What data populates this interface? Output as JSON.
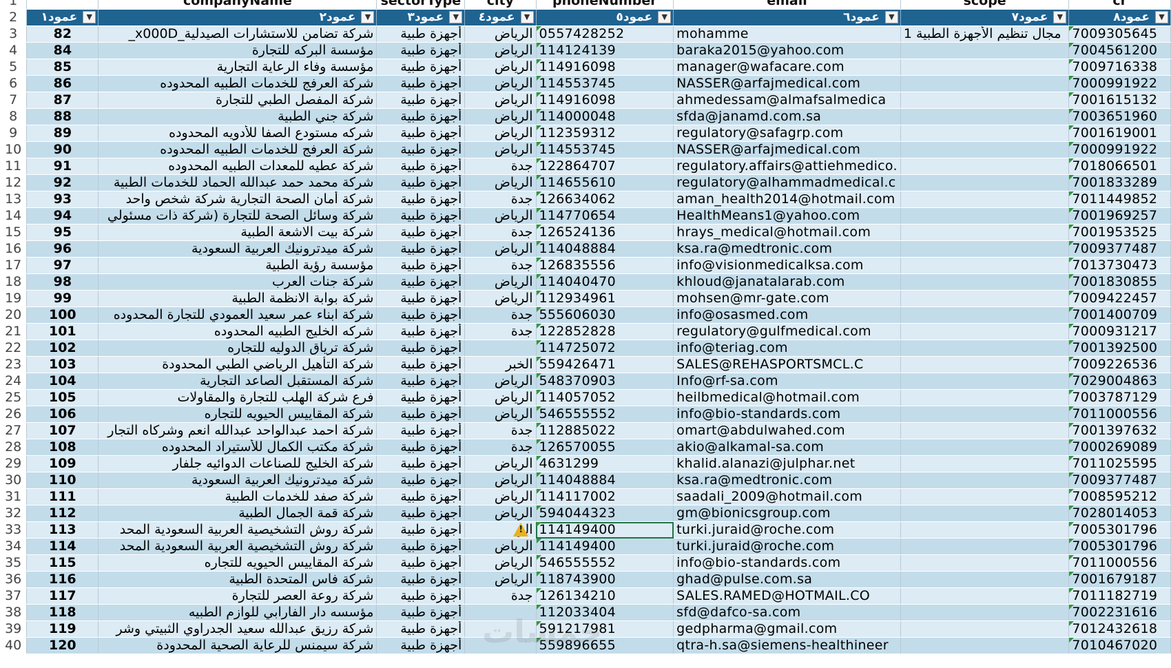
{
  "column_headers": {
    "row_label": "1",
    "companyName": "companyName",
    "sectorType": "sectorType",
    "city": "city",
    "phoneNumber": "phoneNumber",
    "email": "email",
    "scope": "scope",
    "cr": "cr"
  },
  "filter_row": {
    "row_label": "2",
    "col_a": "عمود١",
    "col_b": "عمود٢",
    "col_c": "عمود٣",
    "col_d": "عمود٤",
    "col_e": "عمود٥",
    "col_f": "عمود٦",
    "col_g": "عمود٧",
    "col_h": "عمود٨"
  },
  "rows": [
    {
      "r": "3",
      "num": "82",
      "name": "شركة تضامن للاستشارات الصيدلية_x000D_",
      "sector": "أجهزة طبية",
      "city": "الرياض",
      "phone": "0557428252",
      "email": "mohamme",
      "scope": "مجال تنظيم الأجهزة الطبية 1",
      "cr": "7009305645"
    },
    {
      "r": "4",
      "num": "84",
      "name": "مؤسسة البركه للتجارة",
      "sector": "أجهزة طبية",
      "city": "الرياض",
      "phone": "114124139",
      "email": "baraka2015@yahoo.com",
      "scope": "",
      "cr": "7004561200"
    },
    {
      "r": "5",
      "num": "85",
      "name": "مؤسسة وفاء الرعاية التجارية",
      "sector": "أجهزة طبية",
      "city": "الرياض",
      "phone": "114916098",
      "email": "manager@wafacare.com",
      "scope": "",
      "cr": "7009716338"
    },
    {
      "r": "6",
      "num": "86",
      "name": "شركة العرفج للخدمات الطبيه المحدوده",
      "sector": "أجهزة طبية",
      "city": "الرياض",
      "phone": "114553745",
      "email": "NASSER@arfajmedical.com",
      "scope": "",
      "cr": "7000991922"
    },
    {
      "r": "7",
      "num": "87",
      "name": "شركة المفصل الطبي للتجارة",
      "sector": "أجهزة طبية",
      "city": "الرياض",
      "phone": "114916098",
      "email": "ahmedessam@almafsalmedica",
      "scope": "",
      "cr": "7001615132"
    },
    {
      "r": "8",
      "num": "88",
      "name": "شركة جني الطبية",
      "sector": "أجهزة طبية",
      "city": "الرياض",
      "phone": "114000048",
      "email": "sfda@janamd.com.sa",
      "scope": "",
      "cr": "7003651960"
    },
    {
      "r": "9",
      "num": "89",
      "name": "شركه مستودع الصفا للأدويه المحدوده",
      "sector": "أجهزة طبية",
      "city": "الرياض",
      "phone": "112359312",
      "email": "regulatory@safagrp.com",
      "scope": "",
      "cr": "7001619001"
    },
    {
      "r": "10",
      "num": "90",
      "name": "شركة العرفج للخدمات الطبيه المحدوده",
      "sector": "أجهزة طبية",
      "city": "الرياض",
      "phone": "114553745",
      "email": "NASSER@arfajmedical.com",
      "scope": "",
      "cr": "7000991922"
    },
    {
      "r": "11",
      "num": "91",
      "name": "شركة عطيه للمعدات الطبيه المحدوده",
      "sector": "أجهزة طبية",
      "city": "جدة",
      "phone": "122864707",
      "email": "regulatory.affairs@attiehmedico.",
      "scope": "",
      "cr": "7018066501"
    },
    {
      "r": "12",
      "num": "92",
      "name": "شركة محمد حمد عبدالله الحماد للخدمات الطبية",
      "sector": "أجهزة طبية",
      "city": "الرياض",
      "phone": "114655610",
      "email": "regulatory@alhammadmedical.c",
      "scope": "",
      "cr": "7001833289"
    },
    {
      "r": "13",
      "num": "93",
      "name": "شركة أمان الصحة التجارية شركة شخص واحد",
      "sector": "أجهزة طبية",
      "city": "جدة",
      "phone": "126634062",
      "email": "aman_health2014@hotmail.com",
      "scope": "",
      "cr": "7011449852"
    },
    {
      "r": "14",
      "num": "94",
      "name": "شركة وسائل الصحة للتجارة (شركة ذات مسئولي",
      "sector": "أجهزة طبية",
      "city": "الرياض",
      "phone": "114770654",
      "email": "HealthMeans1@yahoo.com",
      "scope": "",
      "cr": "7001969257"
    },
    {
      "r": "15",
      "num": "95",
      "name": "شركة بيت الاشعة الطبية",
      "sector": "أجهزة طبية",
      "city": "جدة",
      "phone": "126524136",
      "email": "hrays_medical@hotmail.com",
      "scope": "",
      "cr": "7001953525"
    },
    {
      "r": "16",
      "num": "96",
      "name": "شركة ميدترونيك العربية السعودية",
      "sector": "أجهزة طبية",
      "city": "الرياض",
      "phone": "114048884",
      "email": "ksa.ra@medtronic.com",
      "scope": "",
      "cr": "7009377487"
    },
    {
      "r": "17",
      "num": "97",
      "name": "مؤسسة رؤية الطبية",
      "sector": "أجهزة طبية",
      "city": "جدة",
      "phone": "126835556",
      "email": "info@visionmedicalksa.com",
      "scope": "",
      "cr": "7013730473"
    },
    {
      "r": "18",
      "num": "98",
      "name": "شركة جنات العرب",
      "sector": "أجهزة طبية",
      "city": "الرياض",
      "phone": "114040470",
      "email": "khloud@janatalarab.com",
      "scope": "",
      "cr": "7001830855"
    },
    {
      "r": "19",
      "num": "99",
      "name": "شركة بوابة الانظمة الطبية",
      "sector": "أجهزة طبية",
      "city": "الرياض",
      "phone": "112934961",
      "email": "mohsen@mr-gate.com",
      "scope": "",
      "cr": "7009422457"
    },
    {
      "r": "20",
      "num": "100",
      "name": "شركة ابناء عمر سعيد العمودي للتجارة المحدوده",
      "sector": "أجهزة طبية",
      "city": "جدة",
      "phone": "555606030",
      "email": "info@osasmed.com",
      "scope": "",
      "cr": "7001400709"
    },
    {
      "r": "21",
      "num": "101",
      "name": "شركه الخليج الطبيه المحدوده",
      "sector": "أجهزة طبية",
      "city": "جدة",
      "phone": "122852828",
      "email": "regulatory@gulfmedical.com",
      "scope": "",
      "cr": "7000931217"
    },
    {
      "r": "22",
      "num": "102",
      "name": "شركة ترياق الدوليه للتجاره",
      "sector": "أجهزة طبية",
      "city": "",
      "phone": "114725072",
      "email": "info@teriag.com",
      "scope": "",
      "cr": "7001392500"
    },
    {
      "r": "23",
      "num": "103",
      "name": "شركة التأهيل الرياضي الطبي المحدودة",
      "sector": "أجهزة طبية",
      "city": "الخبر",
      "phone": "559426471",
      "email": "SALES@REHASPORTSMCL.C",
      "scope": "",
      "cr": "7009226536"
    },
    {
      "r": "24",
      "num": "104",
      "name": "شركة المستقبل الصاعد التجارية",
      "sector": "أجهزة طبية",
      "city": "الرياض",
      "phone": "548370903",
      "email": "Info@rf-sa.com",
      "scope": "",
      "cr": "7029004863"
    },
    {
      "r": "25",
      "num": "105",
      "name": "فرع شركة الهلب للتجارة والمقاولات",
      "sector": "أجهزة طبية",
      "city": "الرياض",
      "phone": "114057052",
      "email": "heilbmedical@hotmail.com",
      "scope": "",
      "cr": "7003787129"
    },
    {
      "r": "26",
      "num": "106",
      "name": "شركة المقاييس الحيويه للتجاره",
      "sector": "أجهزة طبية",
      "city": "الرياض",
      "phone": "546555552",
      "email": "info@bio-standards.com",
      "scope": "",
      "cr": "7011000556"
    },
    {
      "r": "27",
      "num": "107",
      "name": "شركة احمد عبدالواحد عبدالله انعم وشركاه التجار",
      "sector": "أجهزة طبية",
      "city": "جدة",
      "phone": "112885022",
      "email": "omart@abdulwahed.com",
      "scope": "",
      "cr": "7001397632"
    },
    {
      "r": "28",
      "num": "108",
      "name": "شركة مكتب الكمال للأستيراد المحدوده",
      "sector": "أجهزة طبية",
      "city": "جدة",
      "phone": "126570055",
      "email": "akio@alkamal-sa.com",
      "scope": "",
      "cr": "7000269089"
    },
    {
      "r": "29",
      "num": "109",
      "name": "شركة الخليج للصناعات الدوائيه جلفار",
      "sector": "أجهزة طبية",
      "city": "الرياض",
      "phone": "4631299",
      "email": "khalid.alanazi@julphar.net",
      "scope": "",
      "cr": "7011025595"
    },
    {
      "r": "30",
      "num": "110",
      "name": "شركة ميدترونيك العربية السعودية",
      "sector": "أجهزة طبية",
      "city": "الرياض",
      "phone": "114048884",
      "email": "ksa.ra@medtronic.com",
      "scope": "",
      "cr": "7009377487"
    },
    {
      "r": "31",
      "num": "111",
      "name": "شركة صفد للخدمات الطبية",
      "sector": "أجهزة طبية",
      "city": "الرياض",
      "phone": "114117002",
      "email": "saadali_2009@hotmail.com",
      "scope": "",
      "cr": "7008595212"
    },
    {
      "r": "32",
      "num": "112",
      "name": "شركة قمة الجمال الطبية",
      "sector": "أجهزة طبية",
      "city": "الرياض",
      "phone": "594044323",
      "email": "gm@bionicsgroup.com",
      "scope": "",
      "cr": "7028014053"
    },
    {
      "r": "33",
      "num": "113",
      "name": "شركة روش التشخيصية العربية السعودية المحد",
      "sector": "أجهزة طبية",
      "city": "الر",
      "phone": "114149400",
      "email": "turki.juraid@roche.com",
      "scope": "",
      "cr": "7005301796"
    },
    {
      "r": "34",
      "num": "114",
      "name": "شركة روش التشخيصية العربية السعودية المحد",
      "sector": "أجهزة طبية",
      "city": "الرياض",
      "phone": "114149400",
      "email": "turki.juraid@roche.com",
      "scope": "",
      "cr": "7005301796"
    },
    {
      "r": "35",
      "num": "115",
      "name": "شركة المقاييس الحيويه للتجاره",
      "sector": "أجهزة طبية",
      "city": "الرياض",
      "phone": "546555552",
      "email": "info@bio-standards.com",
      "scope": "",
      "cr": "7011000556"
    },
    {
      "r": "36",
      "num": "116",
      "name": "شركة فاس المتحدة الطبية",
      "sector": "أجهزة طبية",
      "city": "الرياض",
      "phone": "118743900",
      "email": "ghad@pulse.com.sa",
      "scope": "",
      "cr": "7001679187"
    },
    {
      "r": "37",
      "num": "117",
      "name": "شركة روعة العصر للتجارة",
      "sector": "أجهزة طبية",
      "city": "جدة",
      "phone": "126134210",
      "email": "SALES.RAMED@HOTMAIL.CO",
      "scope": "",
      "cr": "7011182719"
    },
    {
      "r": "38",
      "num": "118",
      "name": "مؤسسه دار الفارابي للوازم الطبيه",
      "sector": "أجهزة طبية",
      "city": "",
      "phone": "112033404",
      "email": "sfd@dafco-sa.com",
      "scope": "",
      "cr": "7002231616"
    },
    {
      "r": "39",
      "num": "119",
      "name": "شركة رزيق عبدالله سعيد الجدراوي الثبيتي وشر",
      "sector": "أجهزة طبية",
      "city": "",
      "phone": "591217981",
      "email": "gedpharma@gmail.com",
      "scope": "",
      "cr": "7012432618"
    },
    {
      "r": "40",
      "num": "120",
      "name": "شركة سيمنس للرعاية الصحية المحدودة",
      "sector": "أجهزة طبية",
      "city": "",
      "phone": "559896655",
      "email": "qtra-h.sa@siemens-healthineer",
      "scope": "",
      "cr": "7010467020"
    }
  ],
  "icons": {
    "filter_button": "chevron-down-icon",
    "number_stored_as_text": "green-triangle-indicator",
    "error_check": "warning-icon"
  },
  "watermark": "خمسات"
}
